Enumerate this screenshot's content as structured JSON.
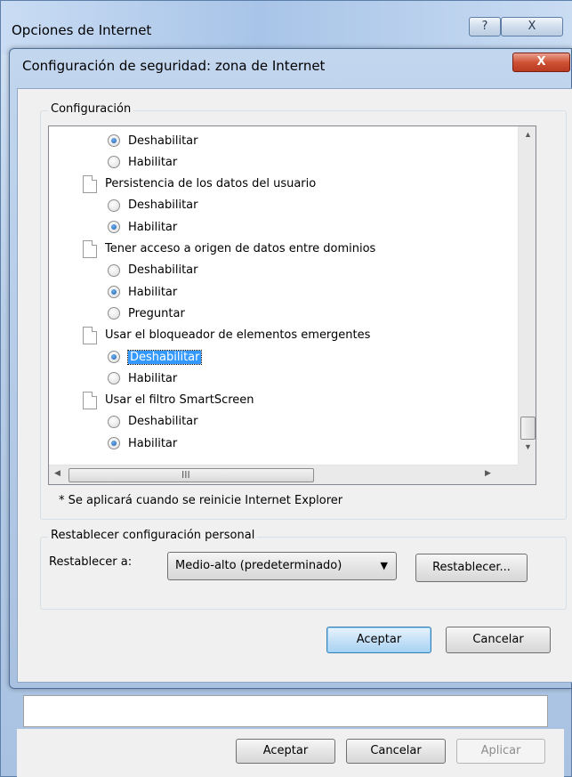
{
  "parent_window": {
    "title": "Opciones de Internet",
    "help_glyph": "?",
    "close_glyph": "X",
    "buttons": {
      "accept": "Aceptar",
      "cancel": "Cancelar",
      "apply": "Aplicar"
    }
  },
  "dialog": {
    "title": "Configuración de seguridad: zona de Internet",
    "close_glyph": "X",
    "settings_group_label": "Configuración",
    "list_items": [
      {
        "kind": "option",
        "label": "Deshabilitar",
        "checked": true
      },
      {
        "kind": "option",
        "label": "Habilitar",
        "checked": false
      },
      {
        "kind": "category",
        "label": "Persistencia de los datos del usuario"
      },
      {
        "kind": "option",
        "label": "Deshabilitar",
        "checked": false
      },
      {
        "kind": "option",
        "label": "Habilitar",
        "checked": true
      },
      {
        "kind": "category",
        "label": "Tener acceso a origen de datos entre dominios"
      },
      {
        "kind": "option",
        "label": "Deshabilitar",
        "checked": false
      },
      {
        "kind": "option",
        "label": "Habilitar",
        "checked": true
      },
      {
        "kind": "option",
        "label": "Preguntar",
        "checked": false
      },
      {
        "kind": "category",
        "label": "Usar el bloqueador de elementos emergentes"
      },
      {
        "kind": "option",
        "label": "Deshabilitar",
        "checked": true,
        "selected": true
      },
      {
        "kind": "option",
        "label": "Habilitar",
        "checked": false
      },
      {
        "kind": "category",
        "label": "Usar el filtro SmartScreen"
      },
      {
        "kind": "option",
        "label": "Deshabilitar",
        "checked": false
      },
      {
        "kind": "option",
        "label": "Habilitar",
        "checked": true
      }
    ],
    "scrollbar": {
      "up": "▲",
      "down": "▼",
      "left": "◀",
      "right": "▶",
      "grip": "III"
    },
    "note": "* Se aplicará cuando se reinicie Internet Explorer",
    "reset_group_label": "Restablecer configuración personal",
    "reset_to_label": "Restablecer a:",
    "reset_select_value": "Medio-alto (predeterminado)",
    "reset_select_arrow": "▼",
    "reset_button": "Restablecer...",
    "accept_button": "Aceptar",
    "cancel_button": "Cancelar"
  },
  "colors": {
    "selection": "#3399ff",
    "dialog_frame": "#a9c1e0",
    "close_button": "#cf5236"
  }
}
